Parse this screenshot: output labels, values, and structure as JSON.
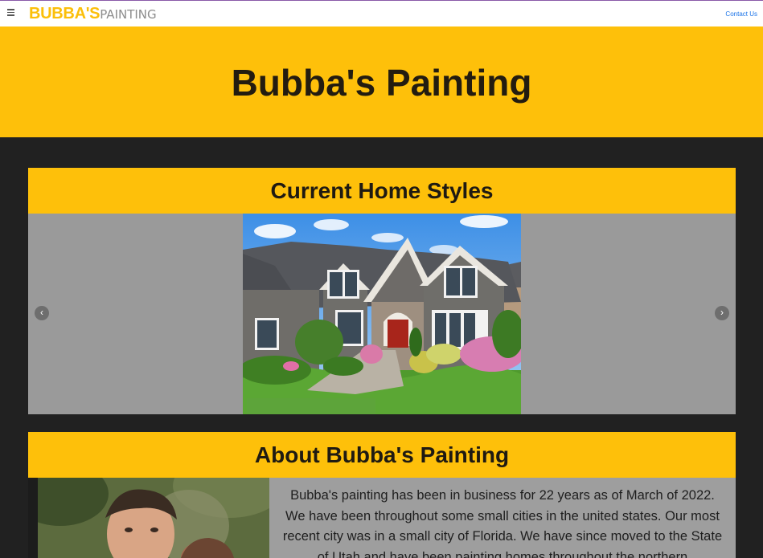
{
  "nav": {
    "brand_bold": "BUBBA'S",
    "brand_light": "PAINTING",
    "contact_label": "Contact Us",
    "menu_icon": "hamburger-icon"
  },
  "hero": {
    "title": "Bubba's Painting"
  },
  "styles_section": {
    "title": "Current Home Styles",
    "prev_icon": "chevron-left-icon",
    "next_icon": "chevron-right-icon",
    "prev_glyph": "‹",
    "next_glyph": "›"
  },
  "about_section": {
    "title": "About Bubba's Painting",
    "text": "Bubba's painting has been in business for 22 years as of March of 2022. We have been throughout some small cities in the united states. Our most recent city was in a small city of Florida. We have since moved to the State of Utah and have been painting homes throughout the northern"
  },
  "colors": {
    "accent": "#fec00a",
    "page_bg": "#212121",
    "carousel_bg": "#9a9a9a",
    "link": "#1a73e8"
  }
}
